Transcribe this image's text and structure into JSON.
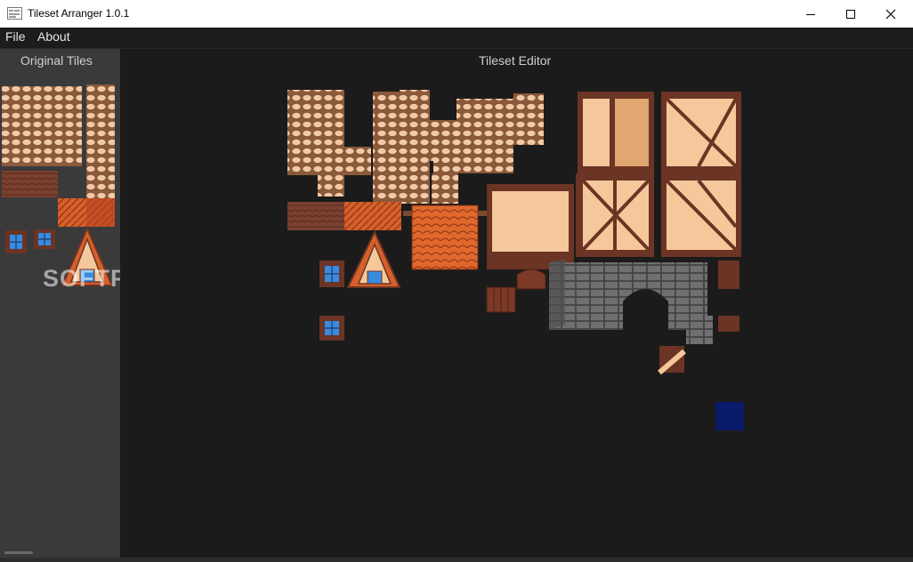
{
  "window": {
    "title": "Tileset Arranger 1.0.1",
    "minimize_icon": "minimize-icon",
    "maximize_icon": "maximize-icon",
    "close_icon": "close-icon"
  },
  "menu": {
    "file": "File",
    "about": "About"
  },
  "left_panel": {
    "title": "Original Tiles"
  },
  "editor": {
    "title": "Tileset Editor"
  },
  "watermark": "SOFTPEDIA",
  "colors": {
    "stone_fill": "#f2c9a6",
    "stone_outline": "#7a4a2c",
    "dirt": "#7a4030",
    "roof": "#d6602a",
    "wall": "#f5c89c",
    "beam": "#6b3424",
    "brick": "#6f6f6f",
    "selection": "#0a1a6a"
  }
}
